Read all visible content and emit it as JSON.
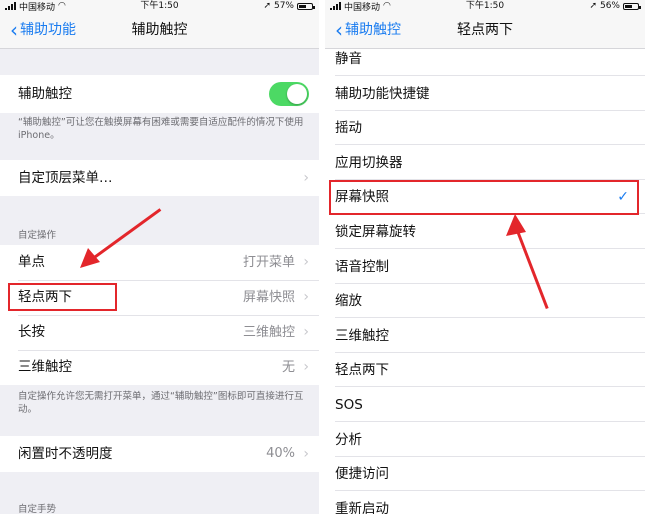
{
  "left": {
    "status": {
      "carrier": "中国移动",
      "time": "下午1:50",
      "battery": "57%",
      "battery_level": 0.57
    },
    "nav": {
      "back": "辅助功能",
      "title": "辅助触控"
    },
    "assistive_touch_label": "辅助触控",
    "assistive_touch_on": true,
    "assistive_touch_footer": "“辅助触控”可让您在触摸屏幕有困难或需要自适应配件的情况下使用 iPhone。",
    "custom_top_menu": "自定顶层菜单…",
    "custom_actions_header": "自定操作",
    "actions": [
      {
        "label": "单点",
        "value": "打开菜单"
      },
      {
        "label": "轻点两下",
        "value": "屏幕快照"
      },
      {
        "label": "长按",
        "value": "三维触控"
      },
      {
        "label": "三维触控",
        "value": "无"
      }
    ],
    "actions_footer": "自定操作允许您无需打开菜单，通过“辅助触控”图标即可直接进行互动。",
    "idle_opacity_label": "闲置时不透明度",
    "idle_opacity_value": "40%",
    "custom_gestures_header": "自定手势"
  },
  "right": {
    "status": {
      "carrier": "中国移动",
      "time": "下午1:50",
      "battery": "56%",
      "battery_level": 0.56
    },
    "nav": {
      "back": "辅助触控",
      "title": "轻点两下"
    },
    "options": [
      {
        "label": "静音",
        "checked": false
      },
      {
        "label": "辅助功能快捷键",
        "checked": false
      },
      {
        "label": "摇动",
        "checked": false
      },
      {
        "label": "应用切换器",
        "checked": false
      },
      {
        "label": "屏幕快照",
        "checked": true
      },
      {
        "label": "锁定屏幕旋转",
        "checked": false
      },
      {
        "label": "语音控制",
        "checked": false
      },
      {
        "label": "缩放",
        "checked": false
      },
      {
        "label": "三维触控",
        "checked": false
      },
      {
        "label": "轻点两下",
        "checked": false
      },
      {
        "label": "SOS",
        "checked": false
      },
      {
        "label": "分析",
        "checked": false
      },
      {
        "label": "便捷访问",
        "checked": false
      },
      {
        "label": "重新启动",
        "checked": false
      }
    ],
    "check_glyph": "✓"
  },
  "colors": {
    "accent": "#1a7cf0",
    "toggle_on": "#4cd964",
    "annotation_red": "#e3262b"
  }
}
